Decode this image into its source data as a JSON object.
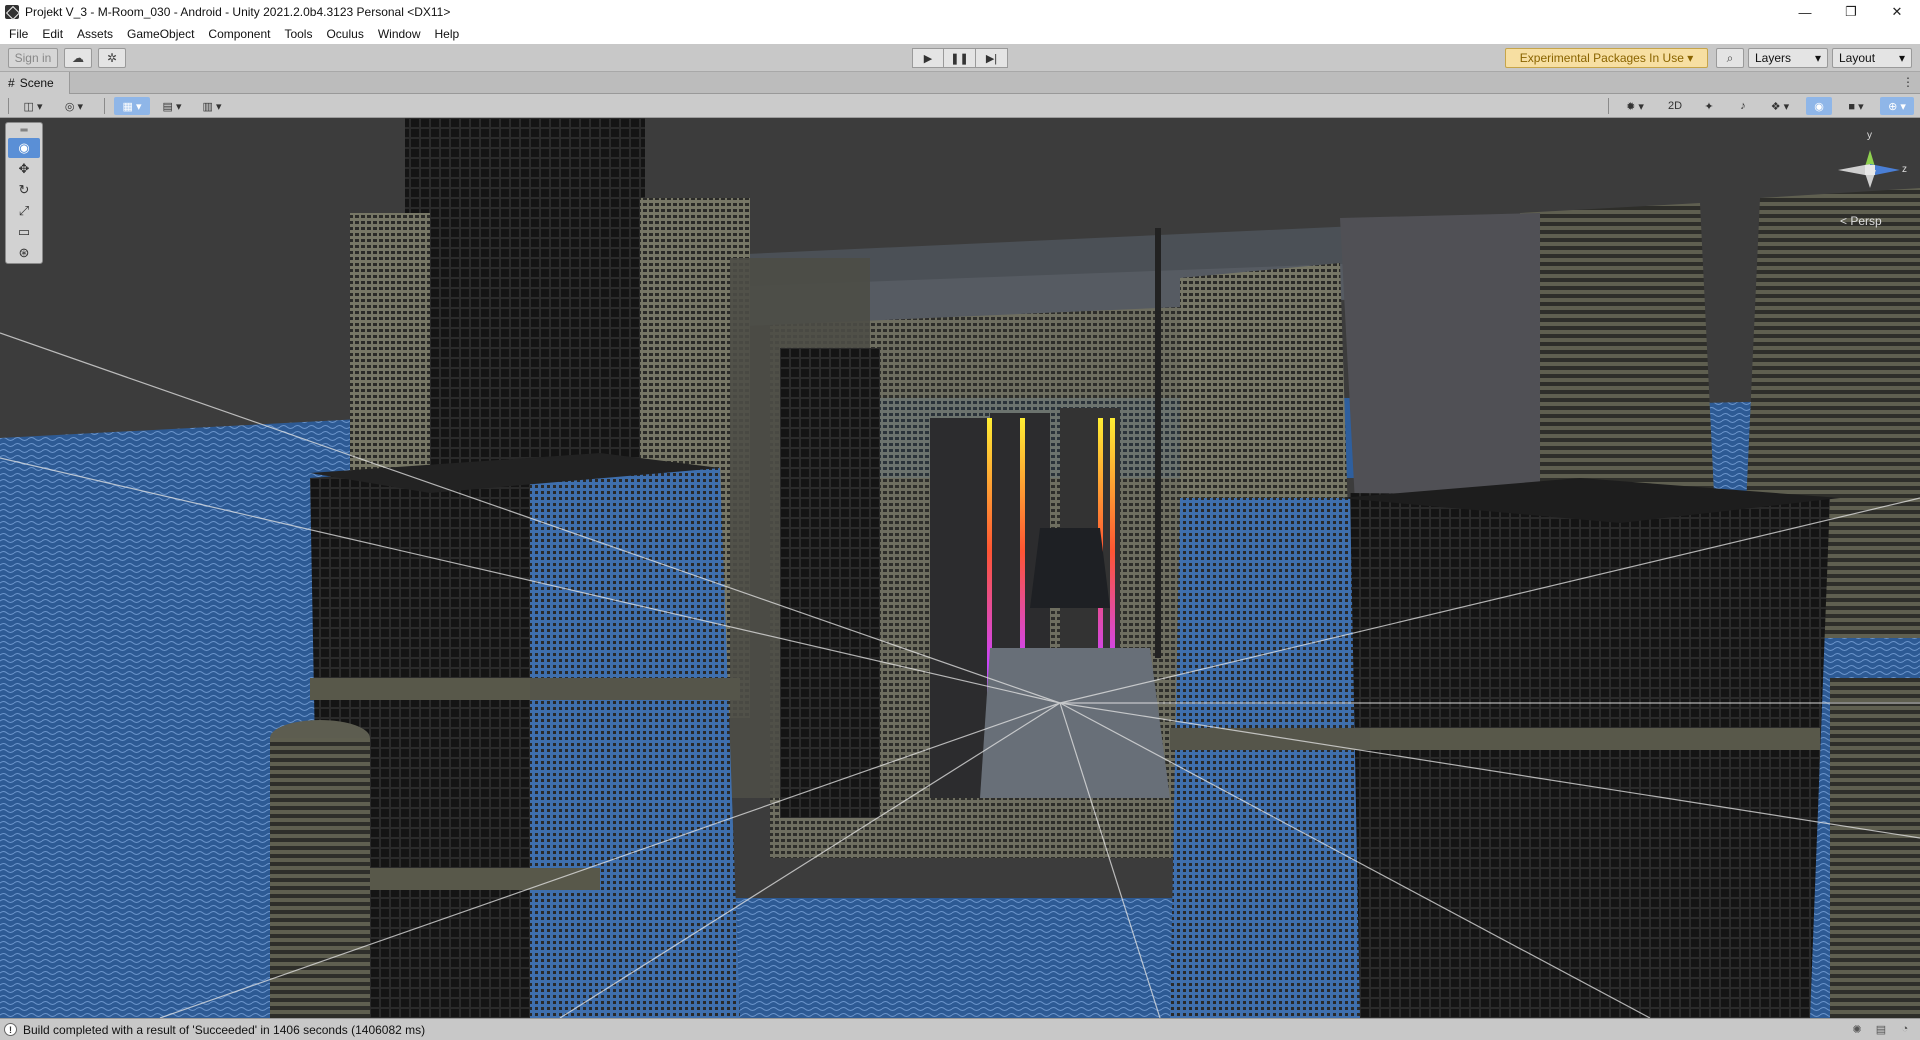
{
  "window": {
    "title": "Projekt V_3 - M-Room_030 - Android - Unity 2021.2.0b4.3123 Personal <DX11>",
    "minimize": "—",
    "restore": "❐",
    "close": "✕"
  },
  "menu": [
    "File",
    "Edit",
    "Assets",
    "GameObject",
    "Component",
    "Tools",
    "Oculus",
    "Window",
    "Help"
  ],
  "toolbar": {
    "sign_in": "Sign in",
    "cloud_icon": "☁",
    "collab_icon": "✲",
    "play_icon": "▶",
    "pause_icon": "❚❚",
    "step_icon": "▶|",
    "experimental": "Experimental Packages In Use ▾",
    "search_icon": "⌕",
    "layers": "Layers",
    "layout": "Layout",
    "dropdown_arrow": "▾"
  },
  "scene_tab": {
    "icon": "#",
    "label": "Scene",
    "menu_icon": "⋮"
  },
  "scene_toolbar": {
    "two_d": "2D"
  },
  "gizmo": {
    "y_label": "y",
    "z_label": "z",
    "persp": "< Persp"
  },
  "status": {
    "icon": "!",
    "message": "Build completed with a result of 'Succeeded' in 1406 seconds (1406082 ms)"
  },
  "colors": {
    "accent": "#5a8fd6",
    "experimental_bg": "#f7dfa2",
    "ocean": "#2d5a94"
  }
}
